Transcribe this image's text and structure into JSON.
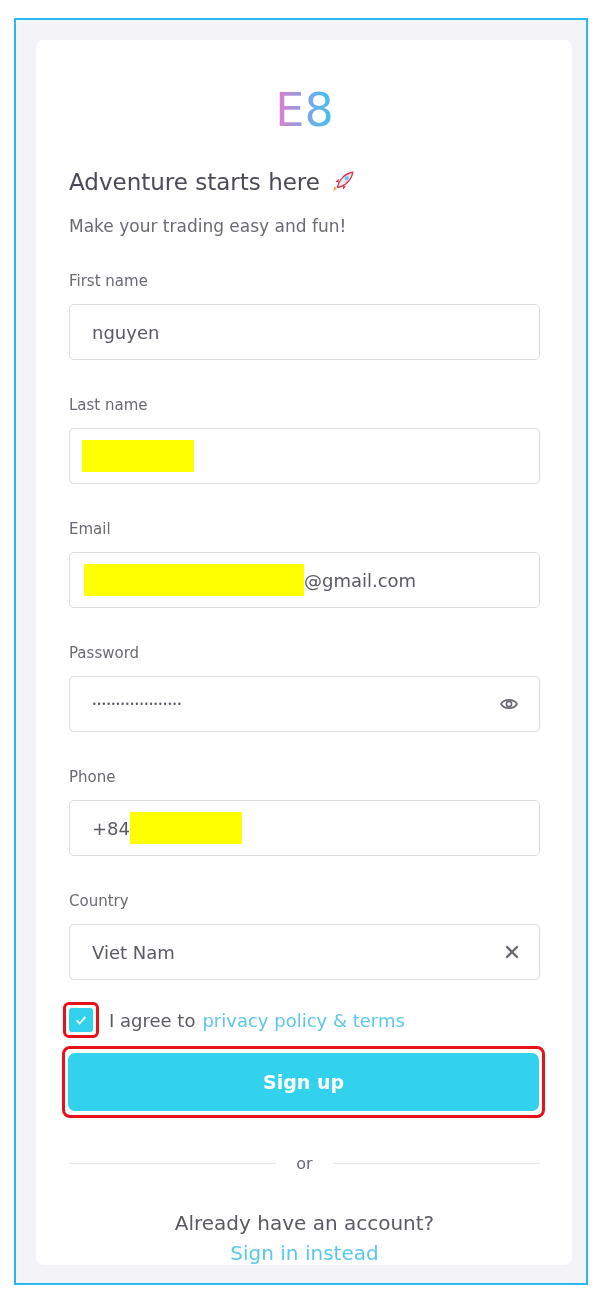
{
  "logo": "E8",
  "heading": "Adventure starts here",
  "subheading": "Make your trading easy and fun!",
  "fields": [
    {
      "label": "First name",
      "value": "nguyen"
    },
    {
      "label": "Last name",
      "redacted_before": true
    },
    {
      "label": "Email",
      "value": "@gmail.com",
      "redacted_before": true
    },
    {
      "label": "Password",
      "value": "•••••••••••••••••••",
      "kind": "password",
      "eye_toggle": true
    },
    {
      "label": "Phone",
      "value": "+84",
      "redacted_after": true
    },
    {
      "label": "Country",
      "value": "Viet Nam",
      "clear_button": true
    }
  ],
  "agree": {
    "checked": true,
    "highlighted": true,
    "text": "I agree to",
    "link": "privacy policy & terms"
  },
  "submit": {
    "label": "Sign up",
    "highlighted": true
  },
  "divider_text": "or",
  "footer": {
    "question": "Already have an account?",
    "link": "Sign in instead"
  }
}
